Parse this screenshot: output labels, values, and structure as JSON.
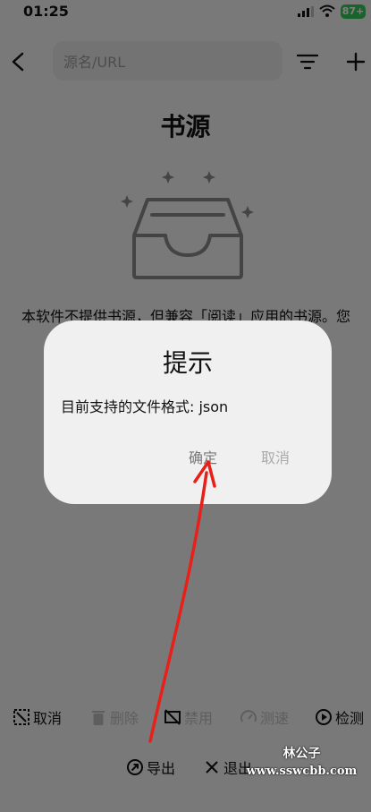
{
  "status_bar": {
    "time": "01:25",
    "battery": "87+"
  },
  "header": {
    "search_placeholder": "源名/URL"
  },
  "page_title": "书源",
  "empty_state": {
    "description": "本软件不提供书源，但兼容「阅读」应用的书源。您可以从本地或者网络导入书源。"
  },
  "bottom_actions": [
    {
      "label": "取消",
      "icon": "select-cancel-icon"
    },
    {
      "label": "删除",
      "icon": "trash-icon"
    },
    {
      "label": "禁用",
      "icon": "disable-icon"
    },
    {
      "label": "测速",
      "icon": "speedometer-icon"
    },
    {
      "label": "检测",
      "icon": "play-circle-icon"
    }
  ],
  "exit_actions": [
    {
      "label": "导出",
      "icon": "export-icon"
    },
    {
      "label": "退出",
      "icon": "close-icon"
    }
  ],
  "dialog": {
    "title": "提示",
    "message": "目前支持的文件格式: json",
    "ok_label": "确定",
    "cancel_label": "取消"
  },
  "watermark": {
    "line1": "林公子",
    "line2": "www.sswcbb.com"
  },
  "colors": {
    "accent_battery": "#34c759",
    "annotation_arrow": "#e8201a"
  }
}
